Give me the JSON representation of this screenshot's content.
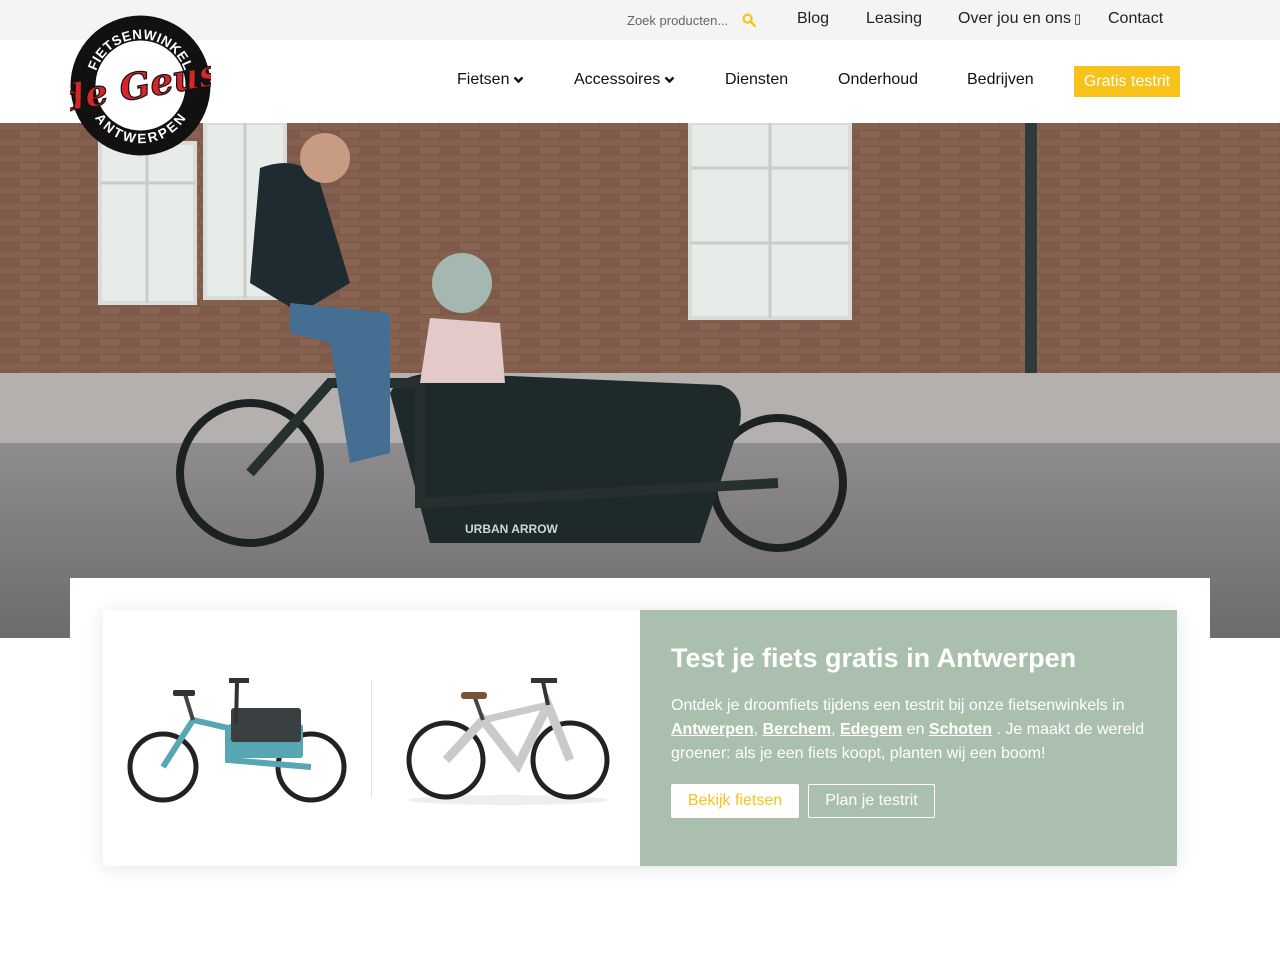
{
  "topbar": {
    "search_placeholder": "Zoek producten...",
    "search_icon": "search-icon",
    "links": [
      {
        "label": "Blog"
      },
      {
        "label": "Leasing"
      },
      {
        "label": "Over jou en ons",
        "icon": "external-link-icon",
        "icon_glyph": "▯"
      },
      {
        "label": "Contact"
      }
    ]
  },
  "logo": {
    "top_text": "FIETSENWINKEL",
    "brand_text": "de Geus",
    "bottom_text": "ANTWERPEN"
  },
  "nav": {
    "items": [
      {
        "label": "Fietsen",
        "has_dropdown": true
      },
      {
        "label": "Accessoires",
        "has_dropdown": true
      },
      {
        "label": "Diensten"
      },
      {
        "label": "Onderhoud"
      },
      {
        "label": "Bedrijven"
      }
    ],
    "cta_label": "Gratis testrit"
  },
  "hero": {
    "bike_brand": "URBAN ARROW"
  },
  "promo": {
    "title": "Test je fiets gratis in Antwerpen",
    "text_intro": "Ontdek je droomfiets tijdens een testrit bij onze fietsenwinkels in",
    "locations": [
      "Antwerpen",
      "Berchem",
      "Edegem",
      "Schoten"
    ],
    "sep_comma": ",",
    "sep_and": "en",
    "text_outro": ". Je maakt de wereld groener: als je een fiets koopt, planten wij een boom!",
    "button_primary": "Bekijk fietsen",
    "button_secondary": "Plan je testrit"
  },
  "colors": {
    "accent": "#f7c21a",
    "card_green": "#abbfae",
    "topbar_bg": "#f4f4f4",
    "logo_red": "#d7262b"
  }
}
